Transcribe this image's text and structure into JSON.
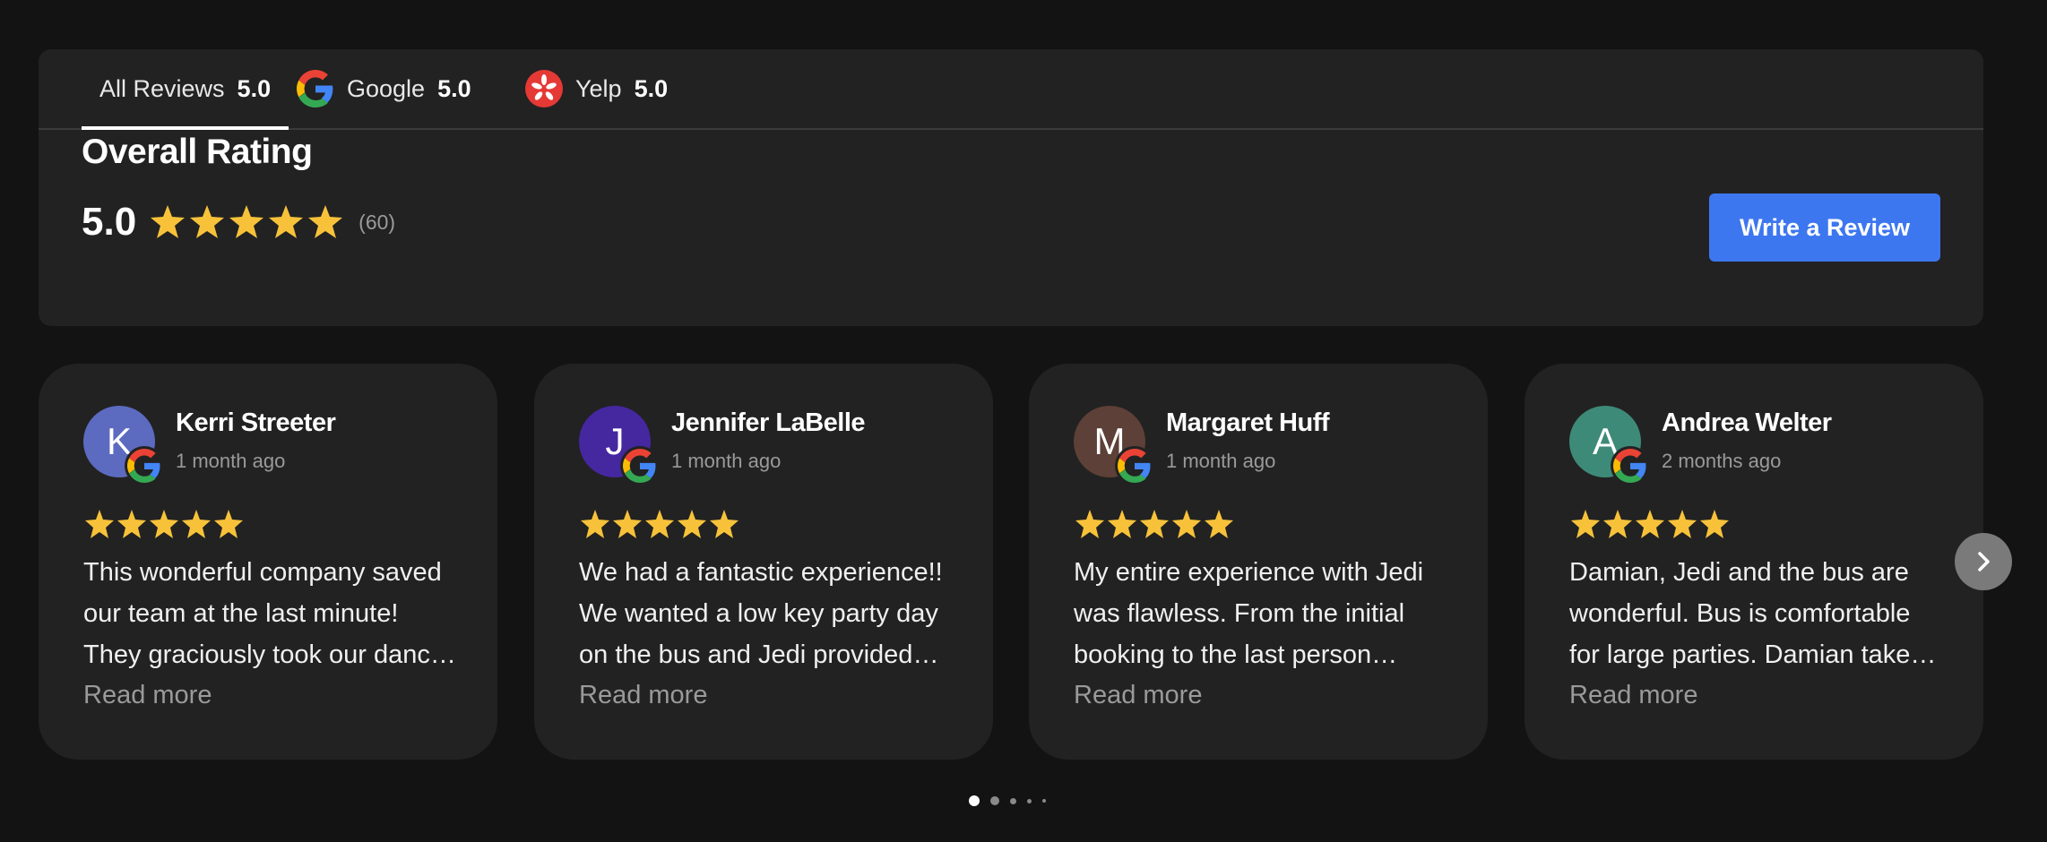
{
  "tabs": [
    {
      "label": "All Reviews",
      "score": "5.0",
      "icon": "list-icon",
      "active": true
    },
    {
      "label": "Google",
      "score": "5.0",
      "icon": "google-icon",
      "active": false
    },
    {
      "label": "Yelp",
      "score": "5.0",
      "icon": "yelp-icon",
      "active": false
    }
  ],
  "overall": {
    "title": "Overall Rating",
    "score": "5.0",
    "stars": 5,
    "count": "(60)"
  },
  "write_review_label": "Write a Review",
  "reviews": [
    {
      "initial": "K",
      "avatar_color": "#5c6bc0",
      "name": "Kerri Streeter",
      "time": "1 month ago",
      "stars": 5,
      "source_icon": "google-icon",
      "text": "This wonderful company saved our team at the last minute! They graciously took our dance team out.",
      "read_more": "Read more"
    },
    {
      "initial": "J",
      "avatar_color": "#4527a0",
      "name": "Jennifer LaBelle",
      "time": "1 month ago",
      "stars": 5,
      "source_icon": "google-icon",
      "text": "We had a fantastic experience!! We wanted a low key party day on the bus and Jedi provided everything.",
      "read_more": "Read more"
    },
    {
      "initial": "M",
      "avatar_color": "#5d4037",
      "name": "Margaret Huff",
      "time": "1 month ago",
      "stars": 5,
      "source_icon": "google-icon",
      "text": "My entire experience with Jedi was flawless. From the initial booking to the last person getting off.",
      "read_more": "Read more"
    },
    {
      "initial": "A",
      "avatar_color": "#3d8a78",
      "name": "Andrea Welter",
      "time": "2 months ago",
      "stars": 5,
      "source_icon": "google-icon",
      "text": "Damian, Jedi and the bus are wonderful. Bus is comfortable for large parties. Damian takes great care.",
      "read_more": "Read more"
    }
  ],
  "pagination": {
    "pages": 5,
    "current": 1
  },
  "colors": {
    "background": "#131313",
    "panel": "#222222",
    "accent": "#3d77f0",
    "star": "#f7c23a",
    "muted": "#9a9a9a"
  }
}
